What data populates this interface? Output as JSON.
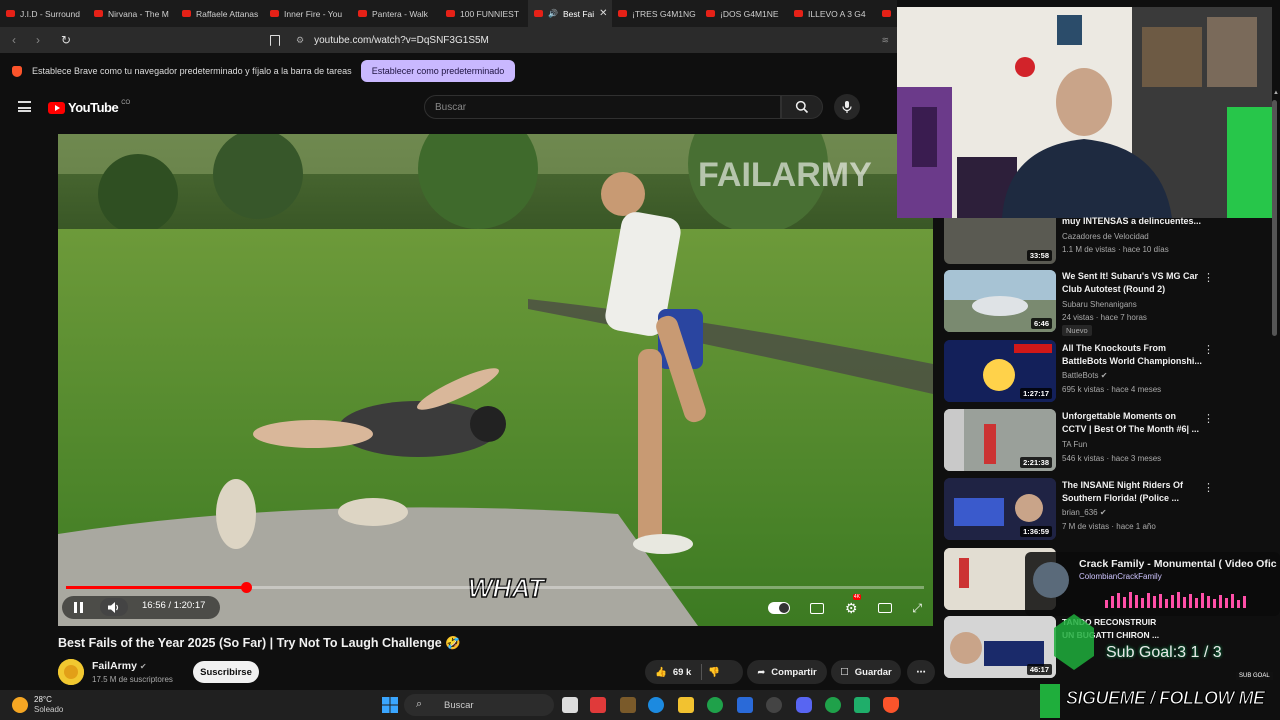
{
  "browser": {
    "tabs": [
      {
        "label": "J.I.D - Surround"
      },
      {
        "label": "Nirvana - The M"
      },
      {
        "label": "Raffaele Attanas"
      },
      {
        "label": "Inner Fire - You"
      },
      {
        "label": "Pantera - Walk"
      },
      {
        "label": "100 FUNNIEST"
      },
      {
        "label": "Best Fai",
        "close": "✕"
      },
      {
        "label": "¡TRES G4M1NG"
      },
      {
        "label": "¡DOS G4M1NE"
      },
      {
        "label": "ILLEVO A 3 G4"
      }
    ],
    "url": "youtube.com/watch?v=DqSNF3G1S5M",
    "brave_prompt": "Establece Brave como tu navegador predeterminado y fíjalo a la barra de tareas",
    "brave_button": "Establecer como predeterminado"
  },
  "youtube": {
    "logo_text": "YouTube",
    "logo_sup": "CO",
    "search_placeholder": "Buscar"
  },
  "video": {
    "watermark": "FAILARMY",
    "caption": "WHAT",
    "time": "16:56 / 1:20:17",
    "progress_fraction": 0.21,
    "title": "Best Fails of the Year 2025 (So Far) | Try Not To Laugh Challenge 🤣",
    "channel": "FailArmy",
    "subscribers": "17.5 M de suscriptores",
    "subscribe": "Suscribirse",
    "likes": "69 k",
    "share": "Compartir",
    "save": "Guardar"
  },
  "recommendations": [
    {
      "title_lines": [
        "muy INTENSAS a delincuentes..."
      ],
      "channel": "Cazadores de Velocidad",
      "meta": "1.1 M de vistas · hace 10 días",
      "duration": "33:58"
    },
    {
      "title_lines": [
        "We Sent It! Subaru's VS MG Car",
        "Club Autotest (Round 2)"
      ],
      "channel": "Subaru Shenanigans",
      "meta": "24 vistas · hace 7 horas",
      "badge": "Nuevo",
      "duration": "6:46"
    },
    {
      "title_lines": [
        "All The Knockouts From",
        "BattleBots World Championshi..."
      ],
      "channel": "BattleBots",
      "meta": "695 k vistas · hace 4 meses",
      "duration": "1:27:17"
    },
    {
      "title_lines": [
        "Unforgettable Moments on",
        "CCTV | Best Of The Month #6| ..."
      ],
      "channel": "TA Fun",
      "meta": "546 k vistas · hace 3 meses",
      "duration": "2:21:38"
    },
    {
      "title_lines": [
        "The INSANE Night Riders Of",
        "Southern Florida! (Police ..."
      ],
      "channel": "brian_636",
      "meta": "7 M de vistas · hace 1 año",
      "duration": "1:36:59"
    },
    {
      "duration": ""
    },
    {
      "duration": "46:17"
    }
  ],
  "stream_overlay": {
    "song": "Crack Family - Monumental ( Video Oficial )",
    "artist": "ColombianCrackFamily",
    "partial_title_1": "TANDO RECONSTRUIR",
    "partial_title_2": "UN BUGATTI CHIRON ...",
    "sub_goal": "Sub Goal:3  1 / 3",
    "sub_goal_small": "SUB GOAL",
    "follow": "SIGUEME / FOLLOW ME"
  },
  "taskbar": {
    "weather_temp": "28°C",
    "weather_desc": "Soleado",
    "search": "Buscar"
  }
}
